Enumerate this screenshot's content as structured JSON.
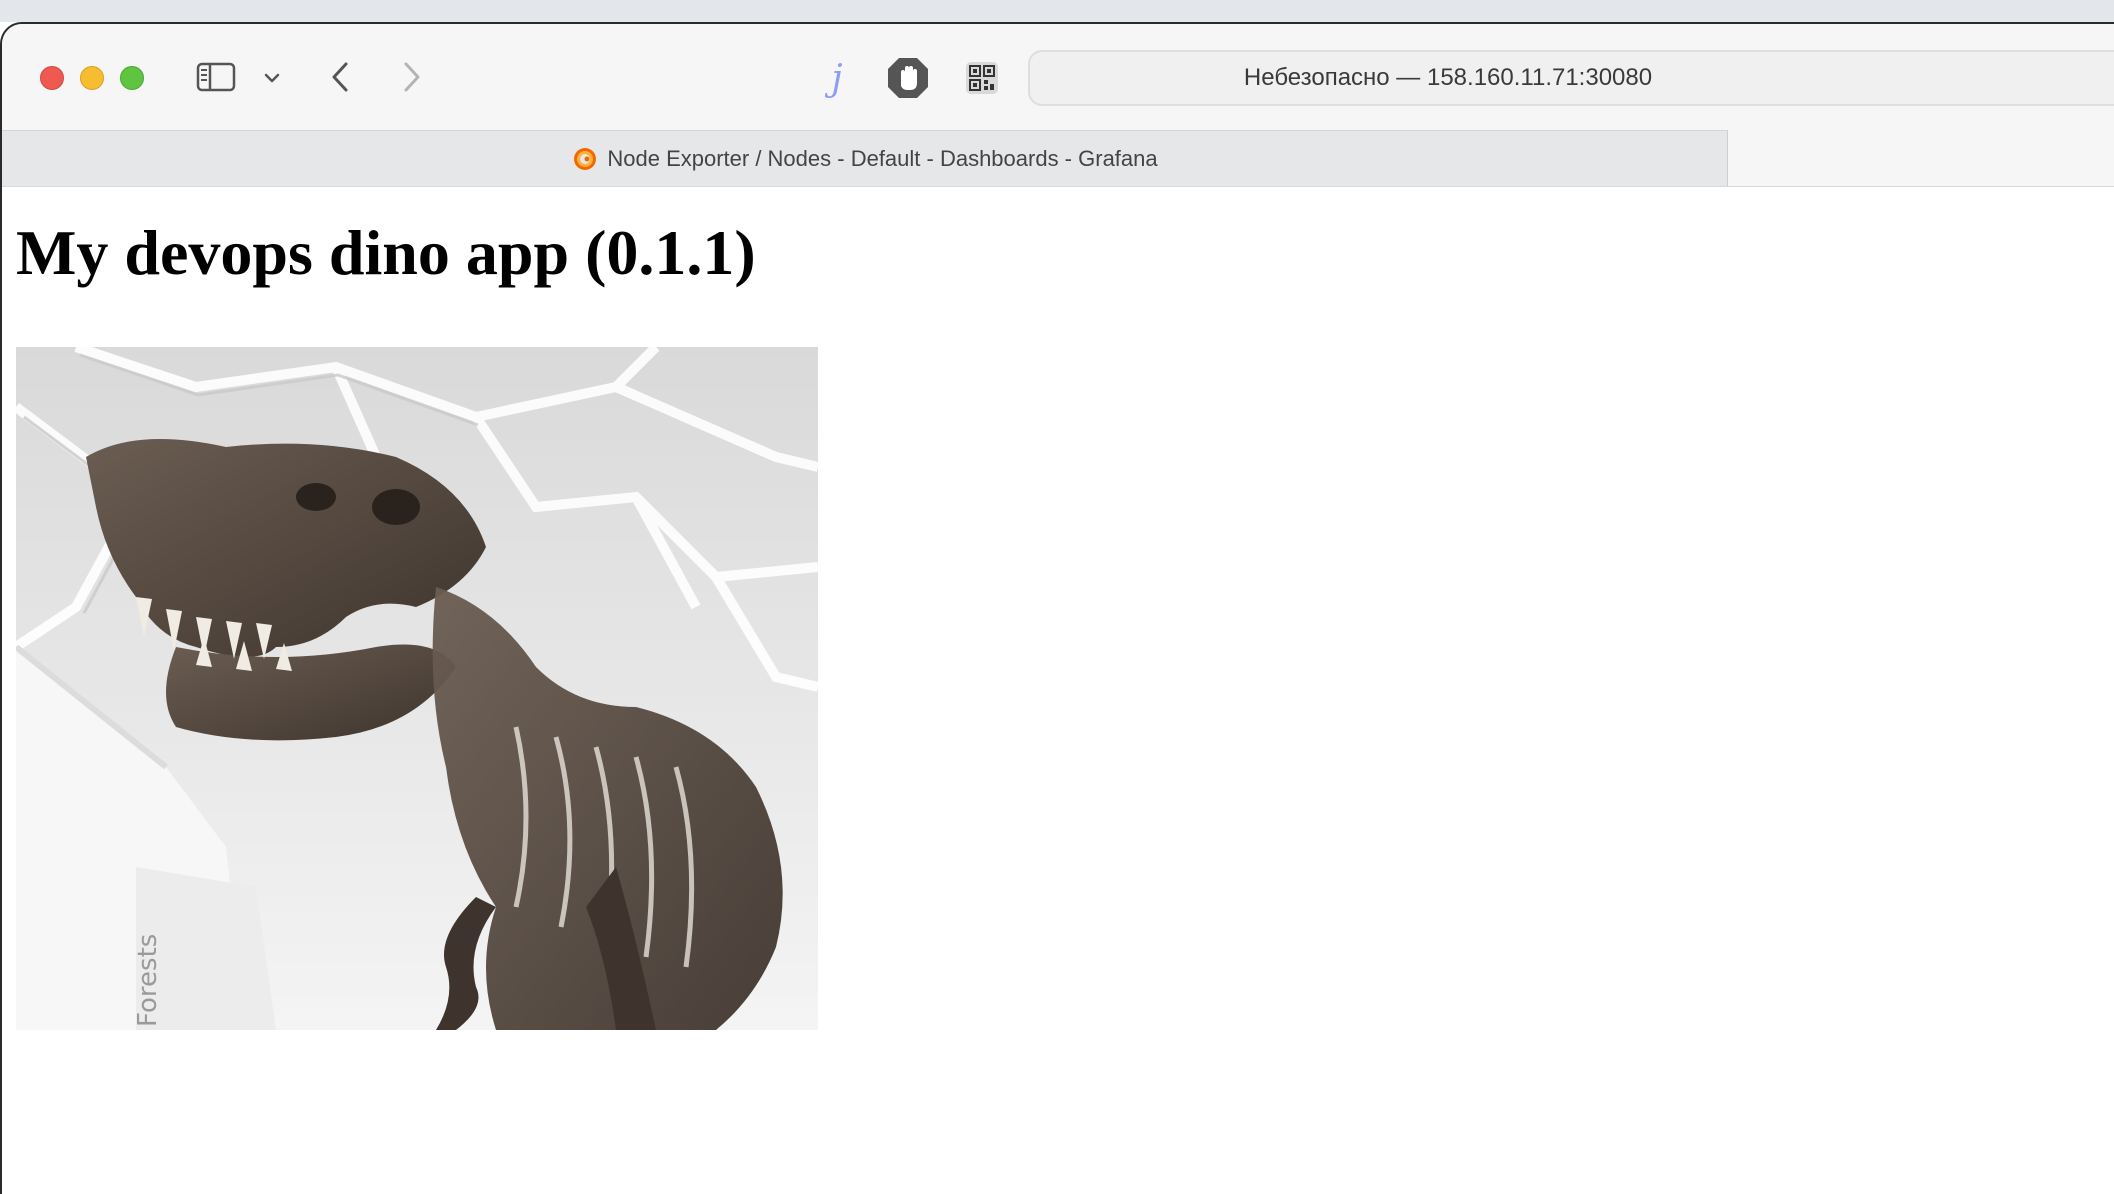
{
  "browser": {
    "address_bar": {
      "text": "Небезопасно — 158.160.11.71:30080"
    },
    "extensions": {
      "j_label": "j"
    },
    "tabs": [
      {
        "title": "Node Exporter / Nodes - Default - Dashboards - Grafana",
        "active": true
      }
    ]
  },
  "page": {
    "heading": "My devops dino app (0.1.1)",
    "image": {
      "alt": "T-rex skeleton",
      "watermark_text": "Forests"
    }
  },
  "colors": {
    "close": "#ee5a52",
    "minimize": "#f5bd2f",
    "maximize": "#5fc440",
    "grafana_orange": "#f46800",
    "extension_j": "#8f9df2"
  }
}
